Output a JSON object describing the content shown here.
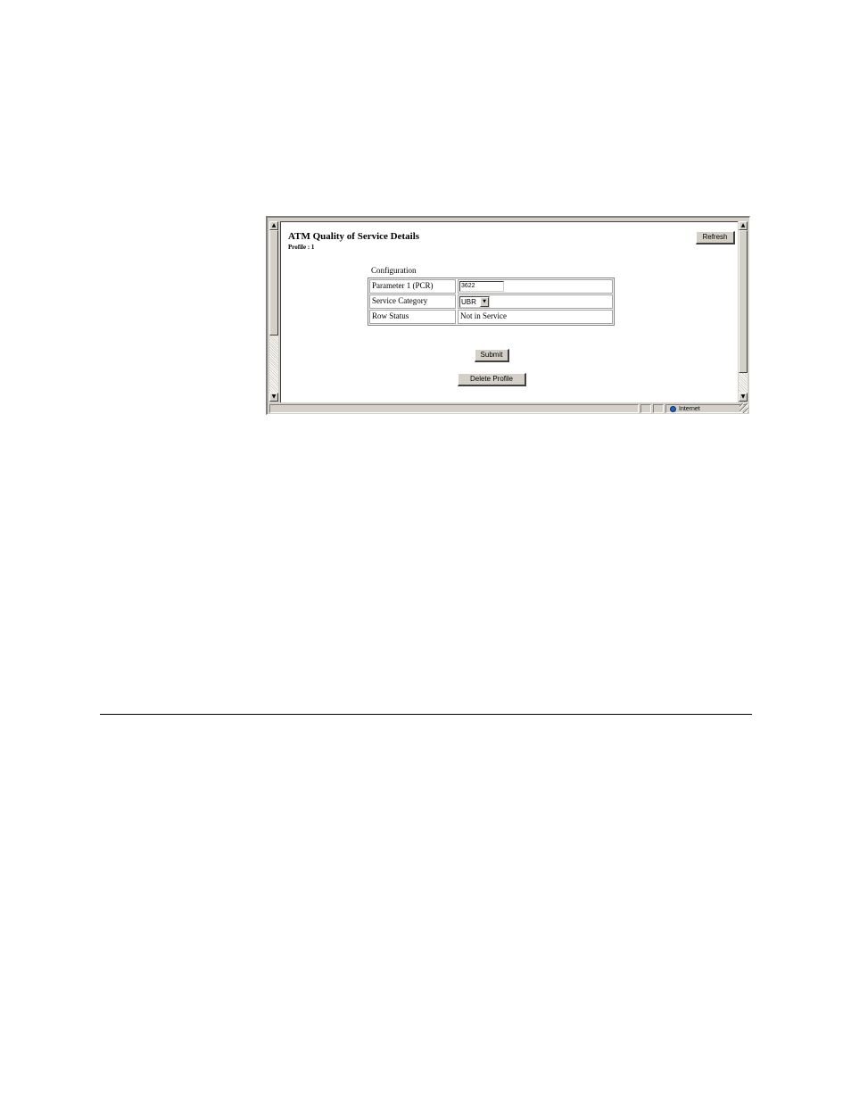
{
  "page": {
    "title": "ATM Quality of Service Details",
    "subtitle": "Profile : 1",
    "refresh_label": "Refresh",
    "config_label": "Configuration",
    "rows": [
      {
        "label": "Parameter 1 (PCR)",
        "value": "3622"
      },
      {
        "label": "Service Category",
        "value": "UBR"
      },
      {
        "label": "Row Status",
        "value": "Not in Service"
      }
    ],
    "submit_label": "Submit",
    "delete_label": "Delete Profile"
  },
  "statusbar": {
    "zone_label": "Internet"
  },
  "icons": {
    "scroll_up": "▲",
    "scroll_down": "▼",
    "dropdown": "▼",
    "zone": "internet-zone-icon"
  }
}
